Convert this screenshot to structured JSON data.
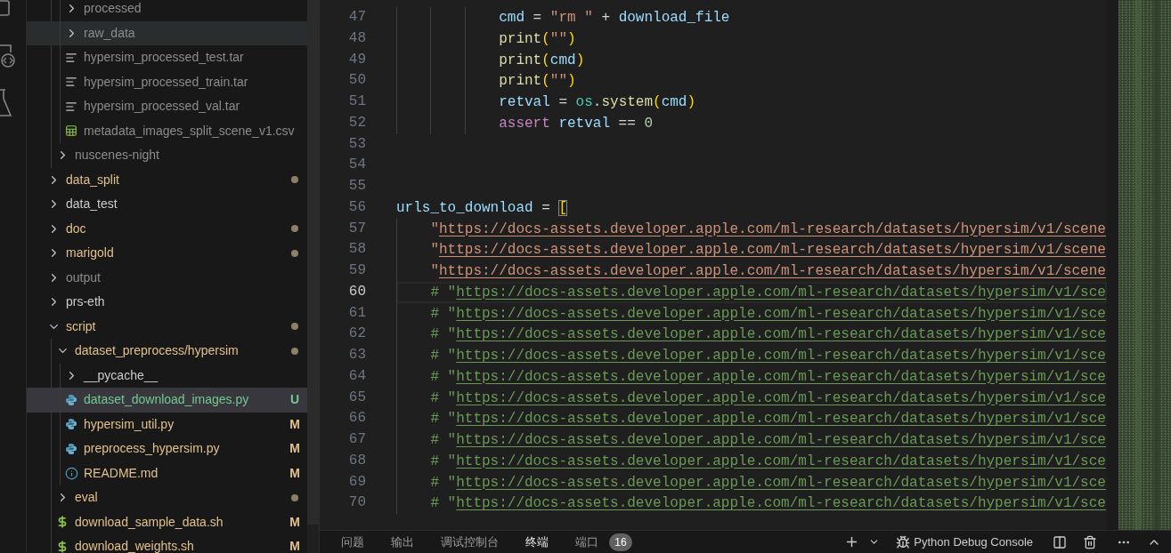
{
  "explorer": {
    "tree": [
      {
        "children": [
          {
            "children": [
              {
                "label": "processed",
                "kind": "folder",
                "expanded": false,
                "color": "#8c8c8c",
                "dot": false,
                "selected": false,
                "hovered": false
              },
              {
                "label": "raw_data",
                "kind": "folder",
                "expanded": false,
                "color": "#8c8c8c",
                "dot": false,
                "selected": false,
                "hovered": true
              },
              {
                "label": "hypersim_processed_test.tar",
                "kind": "text",
                "color": "#8c8c8c",
                "dot": false,
                "selected": false,
                "hovered": false
              },
              {
                "label": "hypersim_processed_train.tar",
                "kind": "text",
                "color": "#8c8c8c",
                "dot": false,
                "selected": false,
                "hovered": false
              },
              {
                "label": "hypersim_processed_val.tar",
                "kind": "text",
                "color": "#8c8c8c",
                "dot": false,
                "selected": false,
                "hovered": false
              },
              {
                "label": "metadata_images_split_scene_v1.csv",
                "kind": "table",
                "color": "#8c8c8c",
                "dot": false,
                "selected": false,
                "hovered": false
              }
            ]
          },
          {
            "label": "nuscenes-night",
            "kind": "folder",
            "expanded": false,
            "color": "#8c8c8c",
            "dot": false,
            "selected": false,
            "hovered": false
          }
        ]
      },
      {
        "label": "data_split",
        "kind": "folder",
        "expanded": false,
        "color": "#e2c08d",
        "dot": true,
        "selected": false,
        "hovered": false
      },
      {
        "label": "data_test",
        "kind": "folder",
        "expanded": false,
        "color": "#cccccc",
        "dot": false,
        "selected": false,
        "hovered": false
      },
      {
        "label": "doc",
        "kind": "folder",
        "expanded": false,
        "color": "#e2c08d",
        "dot": true,
        "selected": false,
        "hovered": false
      },
      {
        "label": "marigold",
        "kind": "folder",
        "expanded": false,
        "color": "#e2c08d",
        "dot": true,
        "selected": false,
        "hovered": false
      },
      {
        "label": "output",
        "kind": "folder",
        "expanded": false,
        "color": "#8c8c8c",
        "dot": false,
        "selected": false,
        "hovered": false
      },
      {
        "label": "prs-eth",
        "kind": "folder",
        "expanded": false,
        "color": "#cccccc",
        "dot": false,
        "selected": false,
        "hovered": false
      },
      {
        "label": "script",
        "kind": "folder",
        "expanded": true,
        "color": "#e2c08d",
        "dot": true,
        "selected": false,
        "hovered": false,
        "children": [
          {
            "label": "dataset_preprocess/hypersim",
            "kind": "folder",
            "expanded": true,
            "color": "#e2c08d",
            "dot": true,
            "selected": false,
            "hovered": false,
            "children": [
              {
                "label": "__pycache__",
                "kind": "folder",
                "expanded": false,
                "color": "#cccccc",
                "dot": false,
                "selected": false,
                "hovered": false
              },
              {
                "label": "dataset_download_images.py",
                "kind": "python",
                "color": "#73c991",
                "badge": "U",
                "dot": false,
                "selected": true,
                "hovered": false
              },
              {
                "label": "hypersim_util.py",
                "kind": "python",
                "color": "#e2c08d",
                "badge": "M",
                "dot": false,
                "selected": false,
                "hovered": false
              },
              {
                "label": "preprocess_hypersim.py",
                "kind": "python",
                "color": "#e2c08d",
                "badge": "M",
                "dot": false,
                "selected": false,
                "hovered": false
              },
              {
                "label": "README.md",
                "kind": "info",
                "color": "#e2c08d",
                "badge": "M",
                "dot": false,
                "selected": false,
                "hovered": false
              }
            ]
          },
          {
            "label": "eval",
            "kind": "folder",
            "expanded": false,
            "color": "#e2c08d",
            "dot": true,
            "selected": false,
            "hovered": false
          },
          {
            "label": "download_sample_data.sh",
            "kind": "shell",
            "color": "#e2c08d",
            "badge": "M",
            "dot": false,
            "selected": false,
            "hovered": false
          },
          {
            "label": "download_weights.sh",
            "kind": "shell",
            "color": "#e2c08d",
            "badge": "M",
            "dot": false,
            "selected": false,
            "hovered": false
          }
        ]
      }
    ]
  },
  "editor": {
    "lines": [
      {
        "number": "47",
        "current": false,
        "kind": "block",
        "tokens": [
          {
            "kind": "var",
            "text": "cmd"
          },
          {
            "kind": "op",
            "text": " = "
          },
          {
            "kind": "str",
            "text": "\"rm \""
          },
          {
            "kind": "op",
            "text": " + "
          },
          {
            "kind": "var",
            "text": "download_file"
          }
        ]
      },
      {
        "number": "48",
        "current": false,
        "kind": "block",
        "tokens": [
          {
            "kind": "func",
            "text": "print"
          },
          {
            "kind": "paren",
            "text": "("
          },
          {
            "kind": "str",
            "text": "\"\""
          },
          {
            "kind": "paren",
            "text": ")"
          }
        ]
      },
      {
        "number": "49",
        "current": false,
        "kind": "block",
        "tokens": [
          {
            "kind": "func",
            "text": "print"
          },
          {
            "kind": "paren",
            "text": "("
          },
          {
            "kind": "var",
            "text": "cmd"
          },
          {
            "kind": "paren",
            "text": ")"
          }
        ]
      },
      {
        "number": "50",
        "current": false,
        "kind": "block",
        "tokens": [
          {
            "kind": "func",
            "text": "print"
          },
          {
            "kind": "paren",
            "text": "("
          },
          {
            "kind": "str",
            "text": "\"\""
          },
          {
            "kind": "paren",
            "text": ")"
          }
        ]
      },
      {
        "number": "51",
        "current": false,
        "kind": "block",
        "tokens": [
          {
            "kind": "var",
            "text": "retval"
          },
          {
            "kind": "op",
            "text": " = "
          },
          {
            "kind": "module",
            "text": "os"
          },
          {
            "kind": "op",
            "text": "."
          },
          {
            "kind": "func",
            "text": "system"
          },
          {
            "kind": "paren",
            "text": "("
          },
          {
            "kind": "var",
            "text": "cmd"
          },
          {
            "kind": "paren",
            "text": ")"
          }
        ]
      },
      {
        "number": "52",
        "current": false,
        "kind": "block",
        "tokens": [
          {
            "kind": "kw",
            "text": "assert"
          },
          {
            "kind": "var",
            "text": " retval"
          },
          {
            "kind": "op",
            "text": " == "
          },
          {
            "kind": "num",
            "text": "0"
          }
        ]
      },
      {
        "number": "53",
        "current": false,
        "kind": "blank"
      },
      {
        "number": "54",
        "current": false,
        "kind": "blank"
      },
      {
        "number": "55",
        "current": false,
        "kind": "blank"
      },
      {
        "number": "56",
        "current": false,
        "kind": "top",
        "tokens": [
          {
            "kind": "var",
            "text": "urls_to_download"
          },
          {
            "kind": "op",
            "text": " = "
          },
          {
            "kind": "bracket_match",
            "text": "["
          }
        ]
      },
      {
        "number": "57",
        "current": false,
        "kind": "item",
        "tokens": [
          {
            "kind": "str",
            "text": "\""
          },
          {
            "kind": "link",
            "text": "https://docs-assets.developer.apple.com/ml-research/datasets/hypersim/v1/scene"
          }
        ]
      },
      {
        "number": "58",
        "current": false,
        "kind": "item",
        "tokens": [
          {
            "kind": "str",
            "text": "\""
          },
          {
            "kind": "link",
            "text": "https://docs-assets.developer.apple.com/ml-research/datasets/hypersim/v1/scene"
          }
        ]
      },
      {
        "number": "59",
        "current": false,
        "kind": "item",
        "tokens": [
          {
            "kind": "str",
            "text": "\""
          },
          {
            "kind": "link",
            "text": "https://docs-assets.developer.apple.com/ml-research/datasets/hypersim/v1/scene"
          }
        ]
      },
      {
        "number": "60",
        "current": true,
        "kind": "item",
        "tokens": [
          {
            "kind": "comment",
            "text": "# \""
          },
          {
            "kind": "comment_link",
            "text": "https://docs-assets.developer.apple.com/ml-research/datasets/hypersim/v1/sce"
          }
        ]
      },
      {
        "number": "61",
        "current": false,
        "kind": "item",
        "tokens": [
          {
            "kind": "comment",
            "text": "# \""
          },
          {
            "kind": "comment_link",
            "text": "https://docs-assets.developer.apple.com/ml-research/datasets/hypersim/v1/sce"
          }
        ]
      },
      {
        "number": "62",
        "current": false,
        "kind": "item",
        "tokens": [
          {
            "kind": "comment",
            "text": "# \""
          },
          {
            "kind": "comment_link",
            "text": "https://docs-assets.developer.apple.com/ml-research/datasets/hypersim/v1/sce"
          }
        ]
      },
      {
        "number": "63",
        "current": false,
        "kind": "item",
        "tokens": [
          {
            "kind": "comment",
            "text": "# \""
          },
          {
            "kind": "comment_link",
            "text": "https://docs-assets.developer.apple.com/ml-research/datasets/hypersim/v1/sce"
          }
        ]
      },
      {
        "number": "64",
        "current": false,
        "kind": "item",
        "tokens": [
          {
            "kind": "comment",
            "text": "# \""
          },
          {
            "kind": "comment_link",
            "text": "https://docs-assets.developer.apple.com/ml-research/datasets/hypersim/v1/sce"
          }
        ]
      },
      {
        "number": "65",
        "current": false,
        "kind": "item",
        "tokens": [
          {
            "kind": "comment",
            "text": "# \""
          },
          {
            "kind": "comment_link",
            "text": "https://docs-assets.developer.apple.com/ml-research/datasets/hypersim/v1/sce"
          }
        ]
      },
      {
        "number": "66",
        "current": false,
        "kind": "item",
        "tokens": [
          {
            "kind": "comment",
            "text": "# \""
          },
          {
            "kind": "comment_link",
            "text": "https://docs-assets.developer.apple.com/ml-research/datasets/hypersim/v1/sce"
          }
        ]
      },
      {
        "number": "67",
        "current": false,
        "kind": "item",
        "tokens": [
          {
            "kind": "comment",
            "text": "# \""
          },
          {
            "kind": "comment_link",
            "text": "https://docs-assets.developer.apple.com/ml-research/datasets/hypersim/v1/sce"
          }
        ]
      },
      {
        "number": "68",
        "current": false,
        "kind": "item",
        "tokens": [
          {
            "kind": "comment",
            "text": "# \""
          },
          {
            "kind": "comment_link",
            "text": "https://docs-assets.developer.apple.com/ml-research/datasets/hypersim/v1/sce"
          }
        ]
      },
      {
        "number": "69",
        "current": false,
        "kind": "item",
        "tokens": [
          {
            "kind": "comment",
            "text": "# \""
          },
          {
            "kind": "comment_link",
            "text": "https://docs-assets.developer.apple.com/ml-research/datasets/hypersim/v1/sce"
          }
        ]
      },
      {
        "number": "70",
        "current": false,
        "kind": "item",
        "tokens": [
          {
            "kind": "comment",
            "text": "# \""
          },
          {
            "kind": "comment_link",
            "text": "https://docs-assets.developer.apple.com/ml-research/datasets/hypersim/v1/sce"
          }
        ]
      }
    ]
  },
  "panel": {
    "tabs": [
      {
        "label": "问题",
        "selected": false
      },
      {
        "label": "输出",
        "selected": false
      },
      {
        "label": "调试控制台",
        "selected": false
      },
      {
        "label": "终端",
        "selected": true
      },
      {
        "label": "端口",
        "selected": false,
        "badge": "16"
      }
    ],
    "terminal_name": "Python Debug Console"
  }
}
